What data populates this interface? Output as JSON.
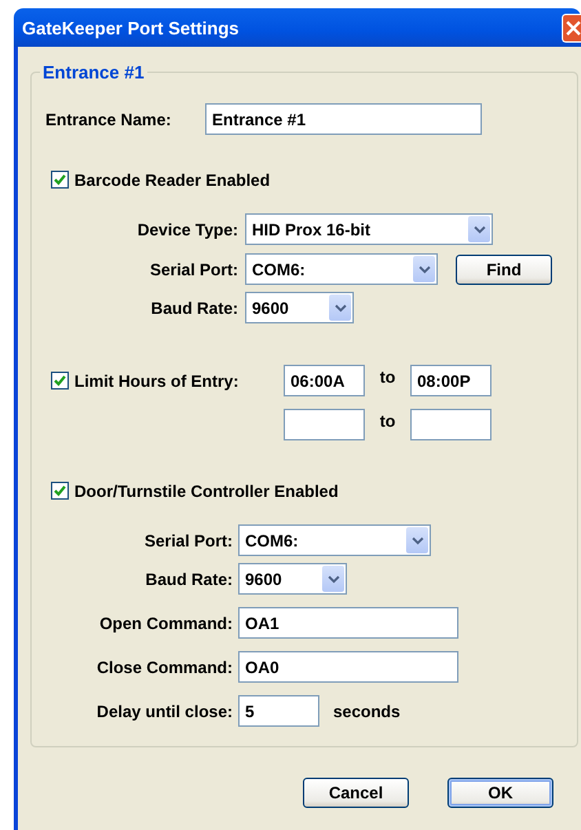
{
  "window": {
    "title": "GateKeeper Port Settings"
  },
  "group": {
    "title": "Entrance #1"
  },
  "entrance_name": {
    "label": "Entrance Name:",
    "value": "Entrance #1"
  },
  "barcode_reader": {
    "label": "Barcode Reader Enabled",
    "checked": true,
    "fields": [
      {
        "kind": "select",
        "label": "Device Type:",
        "value": "HID Prox 16-bit"
      },
      {
        "kind": "select",
        "label": "Serial Port:",
        "value": "COM6:",
        "button": "Find"
      },
      {
        "kind": "select",
        "label": "Baud Rate:",
        "value": "9600"
      }
    ]
  },
  "limit_hours": {
    "label": "Limit Hours of Entry:",
    "checked": true,
    "ranges": [
      {
        "from": "06:00A",
        "separator": "to",
        "to": "08:00P"
      },
      {
        "separator": "to"
      }
    ]
  },
  "door_controller": {
    "label": "Door/Turnstile Controller Enabled",
    "checked": true,
    "fields": [
      {
        "kind": "select",
        "label": "Serial Port:",
        "value": "COM6:"
      },
      {
        "kind": "select",
        "label": "Baud Rate:",
        "value": "9600"
      },
      {
        "kind": "text",
        "label": "Open Command:",
        "value": "OA1"
      },
      {
        "kind": "text",
        "label": "Close Command:",
        "value": "OA0"
      },
      {
        "kind": "text",
        "label": "Delay until close:",
        "value": "5",
        "suffix": "seconds"
      }
    ]
  },
  "buttons": [
    {
      "label": "Cancel",
      "default": false
    },
    {
      "label": "OK",
      "default": true
    }
  ]
}
